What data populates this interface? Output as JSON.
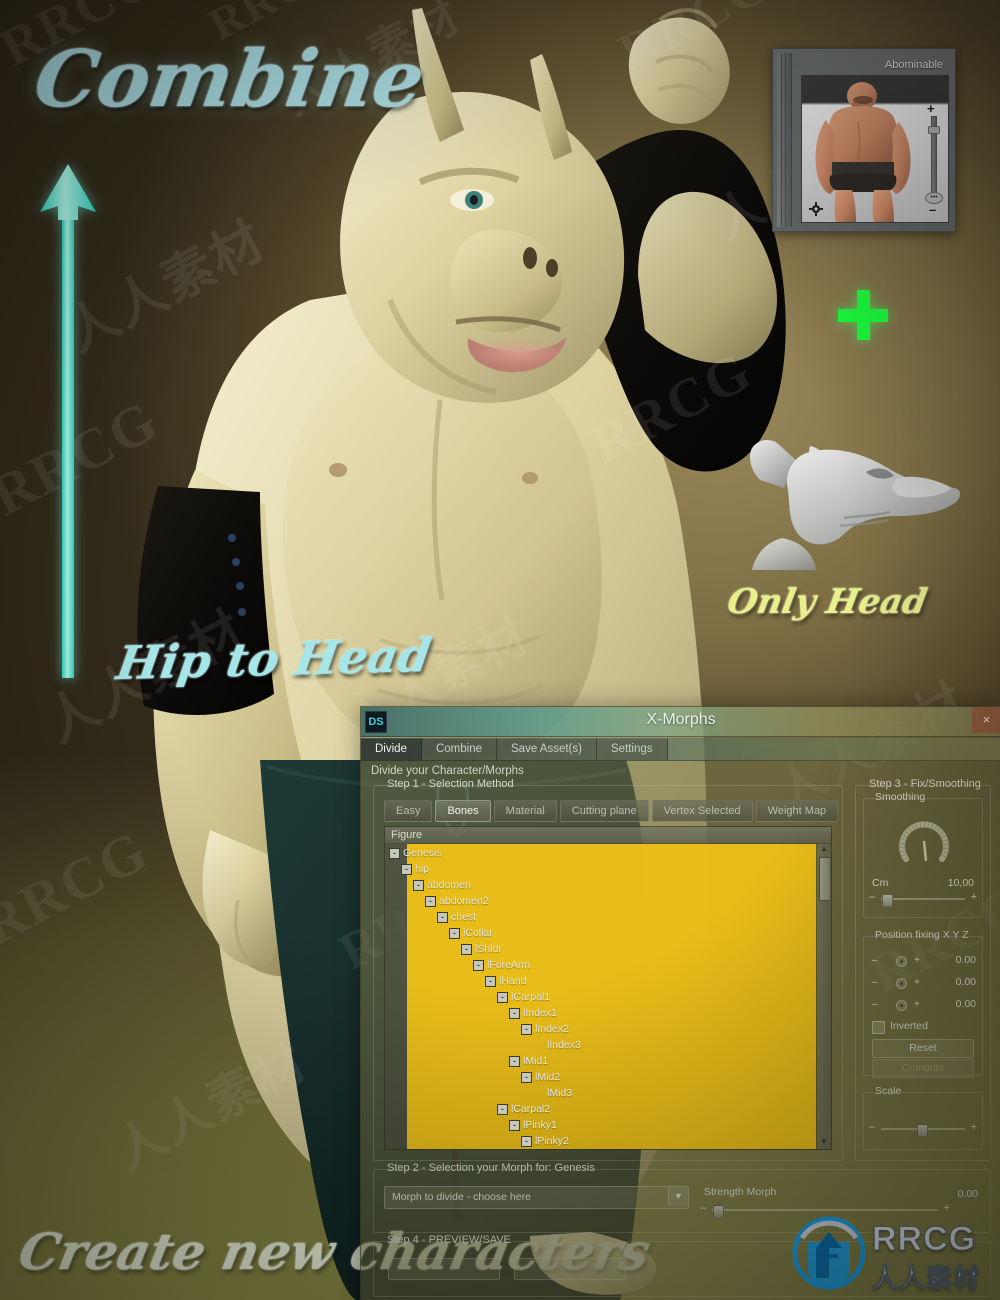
{
  "promo": {
    "title_top": "Combine",
    "label_left_arrow": "Hip to Head",
    "label_right": "Only Head",
    "title_bottom": "Create new characters",
    "plus_sign": "+",
    "accent_cyan": "#a5e7e8",
    "accent_yellow": "#e8f08a",
    "accent_green": "#1dfc3e",
    "arrow_color": "#6ff3e4"
  },
  "watermarks": {
    "latin": "RRCG",
    "cjk": "人人素材"
  },
  "thumb_panel": {
    "title": "Abominable",
    "plus": "+",
    "minus": "–",
    "dots": "•••",
    "gear_icon": "gear-icon"
  },
  "window": {
    "title": "X-Morphs",
    "app_icon_label": "DS",
    "close_label": "×",
    "tabs": [
      {
        "label": "Divide",
        "active": true
      },
      {
        "label": "Combine",
        "active": false
      },
      {
        "label": "Save Asset(s)",
        "active": false
      },
      {
        "label": "Settings",
        "active": false
      }
    ],
    "caption": "Divide your Character/Morphs",
    "step1": {
      "legend": "Step 1 - Selection Method",
      "methods": [
        {
          "label": "Easy",
          "active": false
        },
        {
          "label": "Bones",
          "active": true
        },
        {
          "label": "Material",
          "active": false
        },
        {
          "label": "Cutting plane",
          "active": false
        },
        {
          "label": "Vertex Selected",
          "active": false
        },
        {
          "label": "Weight Map",
          "active": false
        }
      ],
      "tree_header": "Figure",
      "tree": [
        {
          "label": "Genesis",
          "depth": 0,
          "toggle": "-"
        },
        {
          "label": "hip",
          "depth": 1,
          "toggle": "-"
        },
        {
          "label": "abdomen",
          "depth": 2,
          "toggle": "-"
        },
        {
          "label": "abdomen2",
          "depth": 3,
          "toggle": "-"
        },
        {
          "label": "chest",
          "depth": 4,
          "toggle": "-"
        },
        {
          "label": "lCollar",
          "depth": 5,
          "toggle": "-"
        },
        {
          "label": "lShldr",
          "depth": 6,
          "toggle": "-"
        },
        {
          "label": "lForeArm",
          "depth": 7,
          "toggle": "-"
        },
        {
          "label": "lHand",
          "depth": 8,
          "toggle": "-"
        },
        {
          "label": "lCarpal1",
          "depth": 9,
          "toggle": "-"
        },
        {
          "label": "lIndex1",
          "depth": 10,
          "toggle": "-"
        },
        {
          "label": "lIndex2",
          "depth": 11,
          "toggle": "-"
        },
        {
          "label": "lIndex3",
          "depth": 12,
          "toggle": ""
        },
        {
          "label": "lMid1",
          "depth": 10,
          "toggle": "-"
        },
        {
          "label": "lMid2",
          "depth": 11,
          "toggle": "-"
        },
        {
          "label": "lMid3",
          "depth": 12,
          "toggle": ""
        },
        {
          "label": "lCarpal2",
          "depth": 9,
          "toggle": "-"
        },
        {
          "label": "lPinky1",
          "depth": 10,
          "toggle": "-"
        },
        {
          "label": "lPinky2",
          "depth": 11,
          "toggle": "-"
        }
      ],
      "scroll_up": "▲",
      "scroll_down": "▼"
    },
    "step3": {
      "legend": "Step 3 - Fix/Smoothing",
      "smoothing": {
        "legend": "Smoothing",
        "unit_label": "Cm",
        "value": "10,00",
        "slider_min": "–",
        "slider_max": "+"
      },
      "position_fixing": {
        "legend": "Position fixing X Y Z",
        "rows": [
          {
            "axis": "X",
            "value": "0.00",
            "minus": "–",
            "plus": "+"
          },
          {
            "axis": "Y",
            "value": "0.00",
            "minus": "–",
            "plus": "+"
          },
          {
            "axis": "Z",
            "value": "0.00",
            "minus": "–",
            "plus": "+"
          }
        ],
        "inverted_label": "Inverted",
        "reset_label": "Reset",
        "compute_label": "Compute"
      },
      "scale": {
        "legend": "Scale",
        "slider_min": "–",
        "slider_max": "+"
      }
    },
    "step2": {
      "legend": "Step 2 - Selection your Morph for: Genesis",
      "combo_value": "Morph to divide - choose here",
      "combo_caret": "▼",
      "strength_label": "Strength Morph",
      "strength_value": "0.00",
      "slider_min": "–",
      "slider_max": "+"
    },
    "step4": {
      "legend": "Step 4 - PREVIEW/SAVE"
    }
  },
  "logo": {
    "text": "RRCG",
    "cjk": "人人素材"
  }
}
